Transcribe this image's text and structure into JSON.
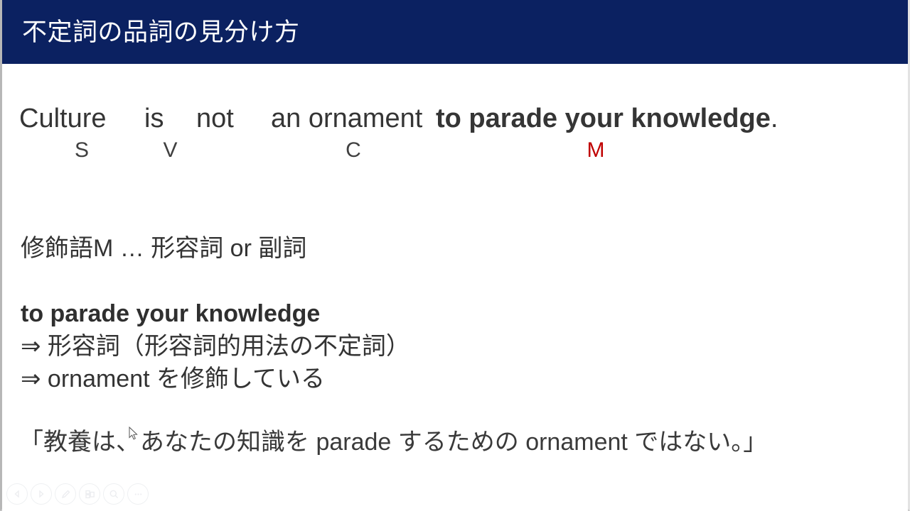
{
  "slide": {
    "title": "不定詞の品詞の見分け方",
    "title_bar_color": "#0b2161",
    "background_color": "#ffffff",
    "accent_color": "#c00000"
  },
  "sentence": {
    "words": {
      "subject": "Culture",
      "verb": "is",
      "negation": "not",
      "complement": "an ornament",
      "modifier": "to parade your knowledge",
      "period": "."
    },
    "labels": {
      "s": "S",
      "v": "V",
      "c": "C",
      "m": "M"
    }
  },
  "explanation": {
    "modifier_rule": "修飾語M … 形容詞 or 副詞",
    "phrase": "to parade your knowledge",
    "arrow1": "⇒ 形容詞（形容詞的用法の不定詞）",
    "arrow2": "⇒ ornament を修飾している",
    "translation": "「教養は、あなたの知識を parade するための ornament ではない。」"
  },
  "controls": [
    {
      "name": "previous-slide-button",
      "icon": "triangle-left-icon"
    },
    {
      "name": "next-slide-button",
      "icon": "triangle-right-icon"
    },
    {
      "name": "pen-tool-button",
      "icon": "pen-icon"
    },
    {
      "name": "slide-overview-button",
      "icon": "grid-slides-icon"
    },
    {
      "name": "zoom-button",
      "icon": "magnifier-icon"
    },
    {
      "name": "more-options-button",
      "icon": "ellipsis-icon"
    }
  ]
}
